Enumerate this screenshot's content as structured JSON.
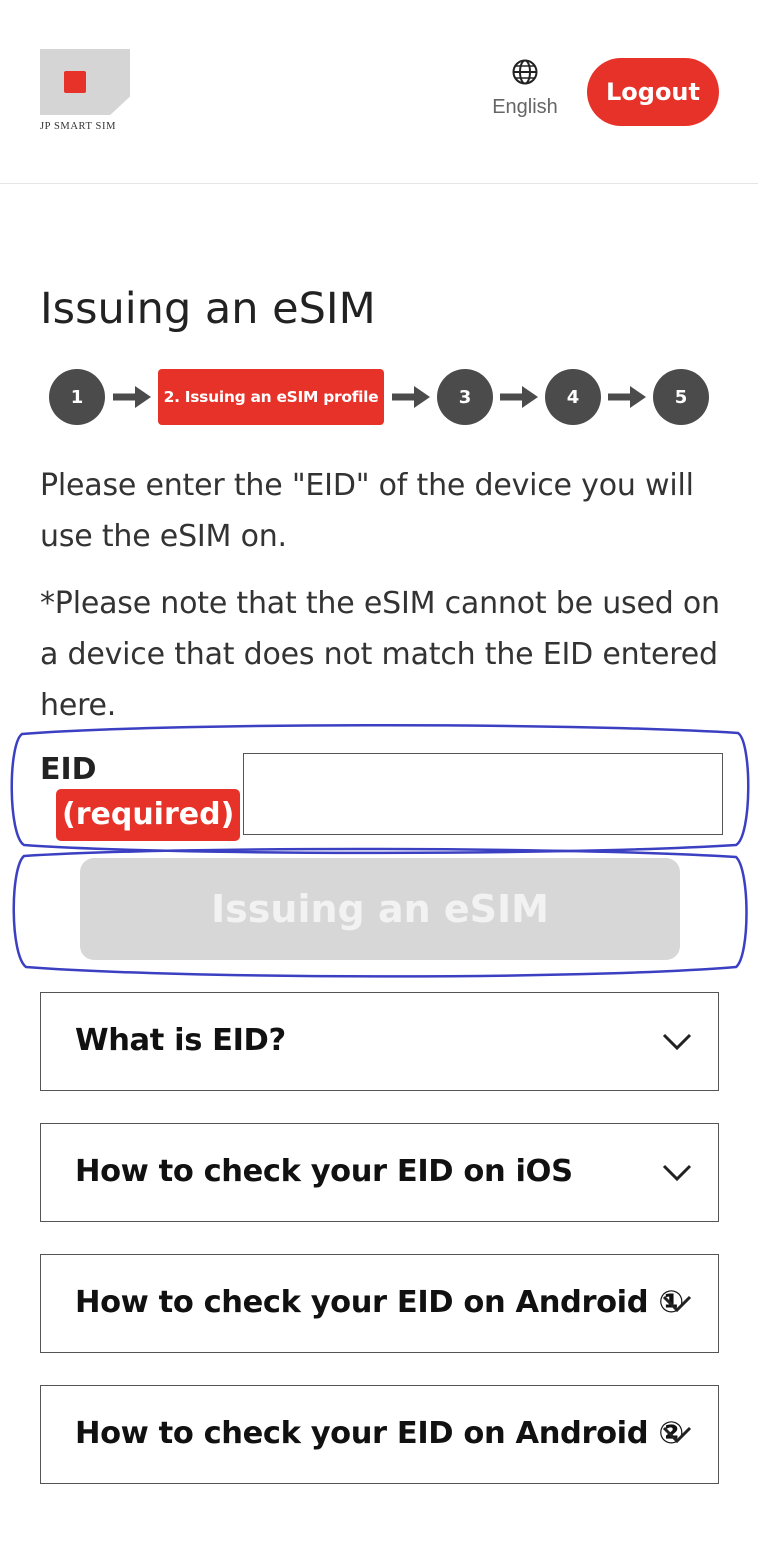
{
  "header": {
    "logo_text": "JP SMART SIM",
    "language_label": "English",
    "logout_label": "Logout"
  },
  "page": {
    "title": "Issuing an eSIM"
  },
  "stepper": {
    "step1": "1",
    "step2_active": "2. Issuing an eSIM profile",
    "step3": "3",
    "step4": "4",
    "step5": "5"
  },
  "instructions": {
    "main": "Please enter the \"EID\" of the device you will use the eSIM on.",
    "note": "*Please note that the eSIM cannot be used on a device that does not match the EID entered here."
  },
  "form": {
    "eid_label": "EID",
    "required_badge": "(required)",
    "eid_value": "",
    "submit_label": "Issuing an eSIM",
    "submit_enabled": false
  },
  "faq": {
    "items": [
      {
        "label": "What is EID?"
      },
      {
        "label": "How to check your EID on iOS"
      },
      {
        "label": "How to check your EID on Android ①"
      },
      {
        "label": "How to check your EID on Android ②"
      }
    ]
  },
  "icons": {
    "language": "globe-icon",
    "expand": "chevron-down-icon",
    "step_arrow": "arrow-right-icon"
  },
  "colors": {
    "brand_red": "#e63228",
    "step_gray": "#4b4b4b",
    "disabled_button": "#d7d7d7",
    "highlight_outline": "#3b3fc2"
  }
}
